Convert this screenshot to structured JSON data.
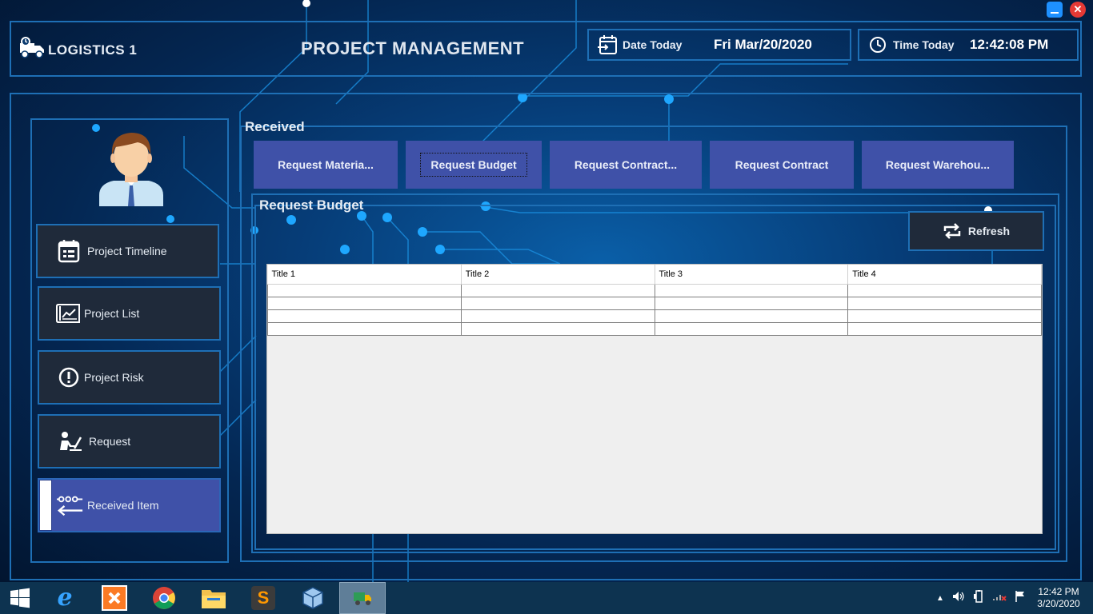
{
  "window": {
    "minimize_label": "minimize",
    "close_glyph": "✕"
  },
  "header": {
    "app_name": "LOGISTICS 1",
    "title": "PROJECT MANAGEMENT",
    "date_label": "Date Today",
    "date_value": "Fri Mar/20/2020",
    "time_label": "Time Today",
    "time_value": "12:42:08 PM"
  },
  "sidebar": {
    "items": [
      {
        "label": "Project Timeline",
        "icon": "calendar-icon"
      },
      {
        "label": "Project List",
        "icon": "chart-document-icon"
      },
      {
        "label": "Project Risk",
        "icon": "warning-icon"
      },
      {
        "label": "Request",
        "icon": "person-request-icon"
      },
      {
        "label": "Received Item",
        "icon": "received-arrow-icon",
        "active": true
      }
    ]
  },
  "received": {
    "title": "Received",
    "tabs": [
      {
        "label": "Request Materia..."
      },
      {
        "label": "Request Budget",
        "selected": true
      },
      {
        "label": "Request Contract..."
      },
      {
        "label": "Request Contract"
      },
      {
        "label": "Request Warehou..."
      }
    ]
  },
  "budget_panel": {
    "title": "Request Budget",
    "refresh_label": "Refresh",
    "table": {
      "columns": [
        "Title 1",
        "Title 2",
        "Title 3",
        "Title 4"
      ],
      "rows": [
        [
          "",
          "",
          "",
          ""
        ],
        [
          "",
          "",
          "",
          ""
        ],
        [
          "",
          "",
          "",
          ""
        ],
        [
          "",
          "",
          "",
          ""
        ]
      ]
    }
  },
  "taskbar": {
    "apps": [
      "windows-start-icon",
      "internet-explorer-icon",
      "xampp-icon",
      "chrome-icon",
      "file-explorer-icon",
      "sublime-text-icon",
      "virtualbox-icon",
      "logistics-app-icon"
    ],
    "clock_time": "12:42 PM",
    "clock_date": "3/20/2020"
  },
  "colors": {
    "accent": "#3f51a8",
    "frame": "#1e6fb5",
    "nav_bg": "#1f2a3a",
    "background": "#063d78"
  }
}
